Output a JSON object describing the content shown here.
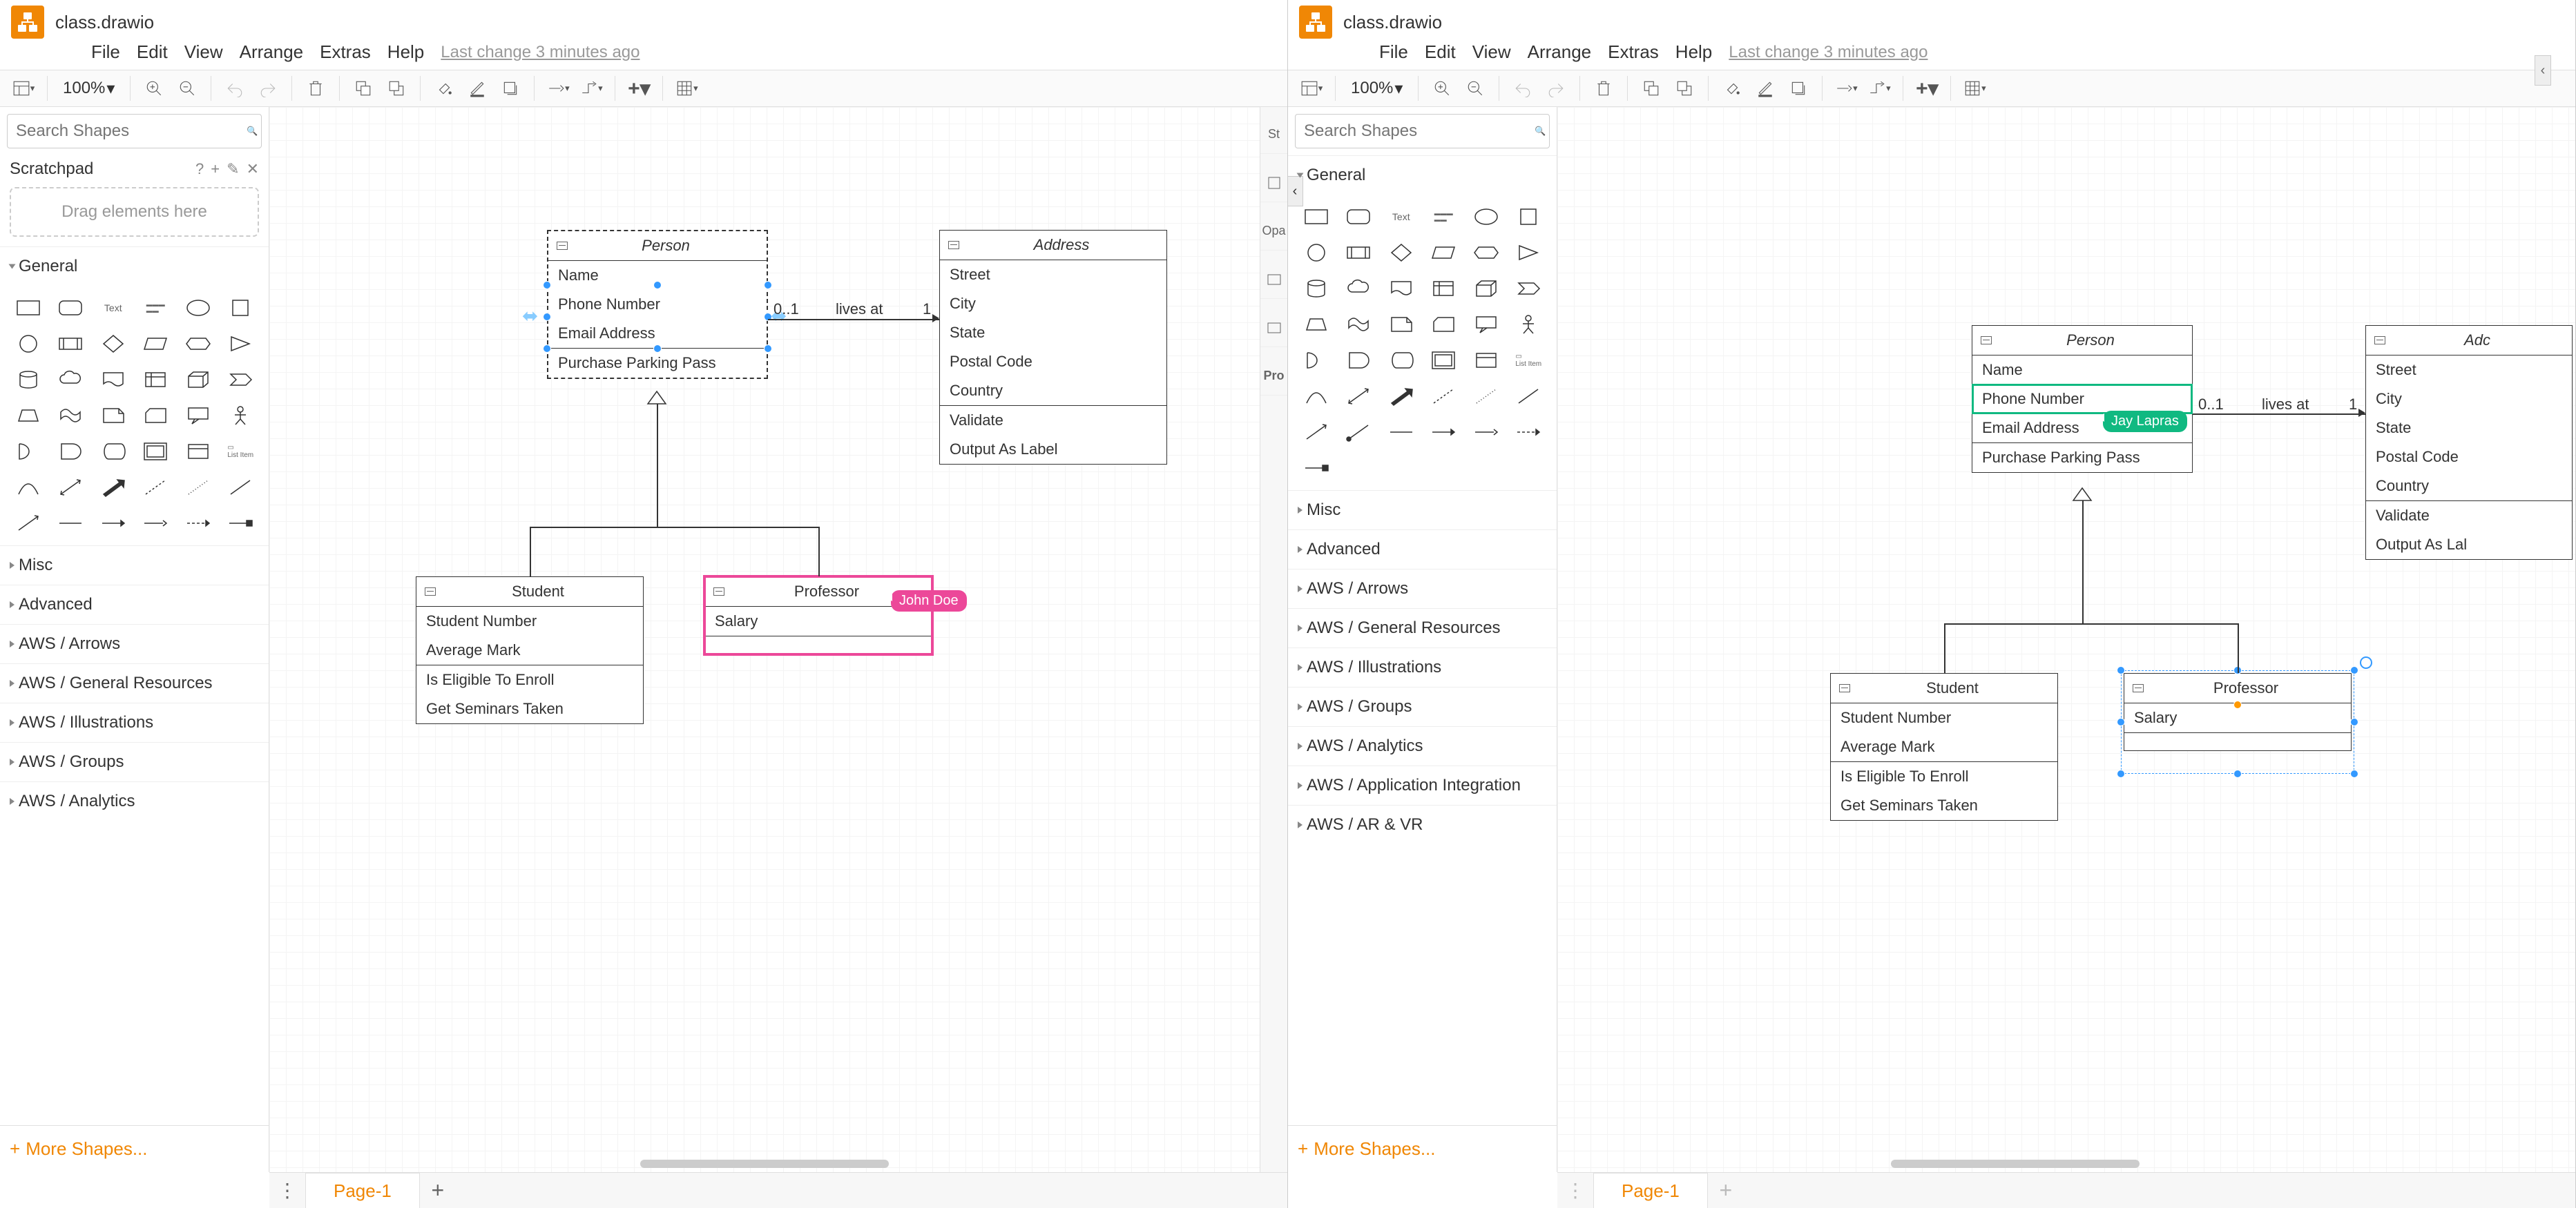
{
  "app": {
    "title": "class.drawio",
    "last_change": "Last change 3 minutes ago",
    "zoom": "100%",
    "page_tab": "Page-1",
    "more_shapes": "More Shapes..."
  },
  "menu": {
    "file": "File",
    "edit": "Edit",
    "view": "View",
    "arrange": "Arrange",
    "extras": "Extras",
    "help": "Help"
  },
  "sidebar": {
    "search_placeholder": "Search Shapes",
    "scratchpad": "Scratchpad",
    "drag_hint": "Drag elements here",
    "general": "General",
    "cats": [
      "Misc",
      "Advanced",
      "AWS / Arrows",
      "AWS / General Resources",
      "AWS / Illustrations",
      "AWS / Groups",
      "AWS / Analytics"
    ],
    "cats2": [
      "Misc",
      "Advanced",
      "AWS / Arrows",
      "AWS / General Resources",
      "AWS / Illustrations",
      "AWS / Groups",
      "AWS / Analytics",
      "AWS / Application Integration",
      "AWS / AR & VR"
    ]
  },
  "strip": {
    "s0": "St",
    "s1": "",
    "s2": "Opa",
    "s3": "",
    "s4": "",
    "s5": "Pro"
  },
  "collab": {
    "user1": "John Doe",
    "user2": "Jay Lapras"
  },
  "diagram": {
    "person": {
      "title": "Person",
      "r0": "Name",
      "r1": "Phone Number",
      "r2": "Email Address",
      "m0": "Purchase Parking Pass"
    },
    "address": {
      "title": "Address",
      "r0": "Street",
      "r1": "City",
      "r2": "State",
      "r3": "Postal Code",
      "r4": "Country",
      "m0": "Validate",
      "m1": "Output As Label"
    },
    "student": {
      "title": "Student",
      "r0": "Student Number",
      "r1": "Average Mark",
      "m0": "Is Eligible To Enroll",
      "m1": "Get Seminars Taken"
    },
    "professor": {
      "title": "Professor",
      "r0": "Salary"
    },
    "edge": {
      "lives_at": "lives at",
      "mult0": "0..1",
      "mult1": "1"
    },
    "address2_title": "Adc",
    "address2_m1": "Output As Lal"
  }
}
